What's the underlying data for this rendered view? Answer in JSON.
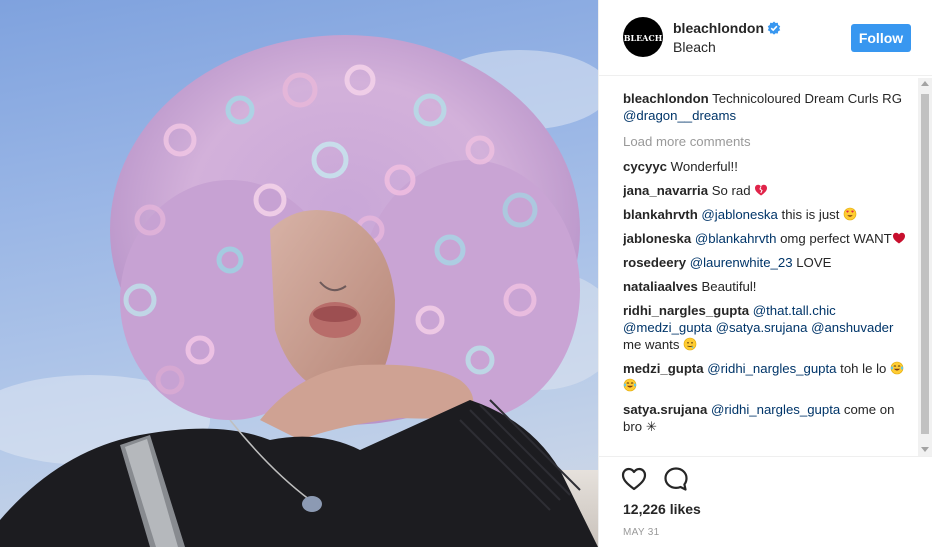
{
  "header": {
    "avatar_logo": "BLEACH",
    "username": "bleachlondon",
    "full_name": "Bleach",
    "follow_label": "Follow",
    "verified_icon": "verified-badge-icon",
    "accent_color": "#3897f0"
  },
  "caption": {
    "user": "bleachlondon",
    "text": " Technicoloured Dream Curls RG ",
    "mention": "@dragon__dreams"
  },
  "load_more": "Load more comments",
  "comments": [
    {
      "user": "cycyyc",
      "parts": [
        {
          "t": " Wonderful!!"
        }
      ]
    },
    {
      "user": "jana_navarria",
      "parts": [
        {
          "t": " So rad "
        }
      ],
      "emoji": "broken-heart-icon"
    },
    {
      "user": "blankahrvth",
      "parts": [
        {
          "t": " "
        },
        {
          "m": "@jabloneska"
        },
        {
          "t": " this is just "
        }
      ],
      "emoji": "heart-eyes-icon"
    },
    {
      "user": "jabloneska",
      "parts": [
        {
          "t": " "
        },
        {
          "m": "@blankahrvth"
        },
        {
          "t": " omg perfect WANT"
        }
      ],
      "emoji": "red-heart-icon"
    },
    {
      "user": "rosedeery",
      "parts": [
        {
          "t": " "
        },
        {
          "m": "@laurenwhite_23"
        },
        {
          "t": " LOVE"
        }
      ]
    },
    {
      "user": "nataliaalves",
      "parts": [
        {
          "t": " Beautiful!"
        }
      ]
    },
    {
      "user": "ridhi_nargles_gupta",
      "parts": [
        {
          "t": " "
        },
        {
          "m": "@that.tall.chic"
        },
        {
          "t": " "
        },
        {
          "m": "@medzi_gupta"
        },
        {
          "t": " "
        },
        {
          "m": "@satya.srujana"
        },
        {
          "t": " "
        },
        {
          "m": "@anshuvader"
        },
        {
          "t": " me wants "
        }
      ],
      "emoji": "drool-face-icon"
    },
    {
      "user": "medzi_gupta",
      "parts": [
        {
          "t": " "
        },
        {
          "m": "@ridhi_nargles_gupta"
        },
        {
          "t": " toh le lo "
        }
      ],
      "emoji": "laughing-tears-icon",
      "emoji_count": 2
    },
    {
      "user": "satya.srujana",
      "parts": [
        {
          "t": " "
        },
        {
          "m": "@ridhi_nargles_gupta"
        },
        {
          "t": " come on bro ✳"
        }
      ]
    }
  ],
  "actions": {
    "like_icon": "heart-outline-icon",
    "comment_icon": "speech-bubble-icon",
    "likes": "12,226 likes",
    "date": "MAY 31"
  }
}
